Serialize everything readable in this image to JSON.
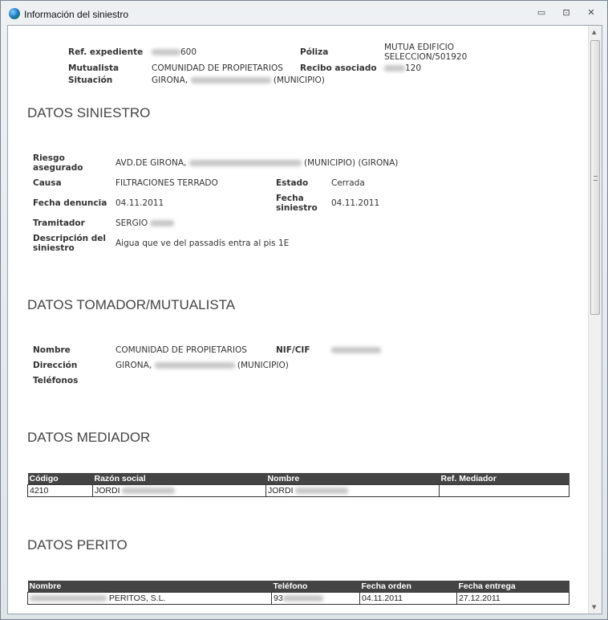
{
  "window": {
    "title": "Información del siniestro",
    "minimize": "▭",
    "maximize": "⊡",
    "close": "✕"
  },
  "header": {
    "ref_label": "Ref. expediente",
    "ref_value": "600",
    "poliza_label": "Póliza",
    "poliza_value_1": "MUTUA EDIFICIO",
    "poliza_value_2": "SELECCION/501920",
    "mutualista_label": "Mutualista",
    "mutualista_value": "COMUNIDAD DE PROPIETARIOS",
    "recibo_label": "Recibo asociado",
    "recibo_value": "120",
    "situacion_label": "Situación",
    "situacion_prefix": "GIRONA,",
    "situacion_suffix": "(MUNICIPIO)"
  },
  "siniestro": {
    "title": "DATOS SINIESTRO",
    "riesgo_label_1": "Riesgo",
    "riesgo_label_2": "asegurado",
    "riesgo_prefix": "AVD.DE GIRONA,",
    "riesgo_suffix": "(MUNICIPIO) (GIRONA)",
    "causa_label": "Causa",
    "causa_value": "FILTRACIONES TERRADO",
    "estado_label": "Estado",
    "estado_value": "Cerrada",
    "fecha_denuncia_label": "Fecha denuncia",
    "fecha_denuncia_value": "04.11.2011",
    "fecha_siniestro_label_1": "Fecha",
    "fecha_siniestro_label_2": "siniestro",
    "fecha_siniestro_value": "04.11.2011",
    "tramitador_label": "Tramitador",
    "tramitador_value": "SERGIO",
    "descripcion_label_1": "Descripción del",
    "descripcion_label_2": "siniestro",
    "descripcion_value": "Aigua que ve del passadís entra al pis 1E"
  },
  "tomador": {
    "title": "DATOS TOMADOR/MUTUALISTA",
    "nombre_label": "Nombre",
    "nombre_value": "COMUNIDAD DE PROPIETARIOS",
    "nif_label": "NIF/CIF",
    "direccion_label": "Dirección",
    "direccion_prefix": "GIRONA,",
    "direccion_suffix": "(MUNICIPIO)",
    "telefonos_label": "Teléfonos"
  },
  "mediador": {
    "title": "DATOS MEDIADOR",
    "columns": [
      "Código",
      "Razón social",
      "Nombre",
      "Ref. Mediador"
    ],
    "rows": [
      [
        "4210",
        "JORDI",
        "JORDI",
        ""
      ]
    ]
  },
  "perito": {
    "title": "DATOS PERITO",
    "columns": [
      "Nombre",
      "Teléfono",
      "Fecha orden",
      "Fecha entrega"
    ],
    "rows": [
      [
        "PERITOS, S.L.",
        "93",
        "04.11.2011",
        "27.12.2011"
      ]
    ]
  }
}
